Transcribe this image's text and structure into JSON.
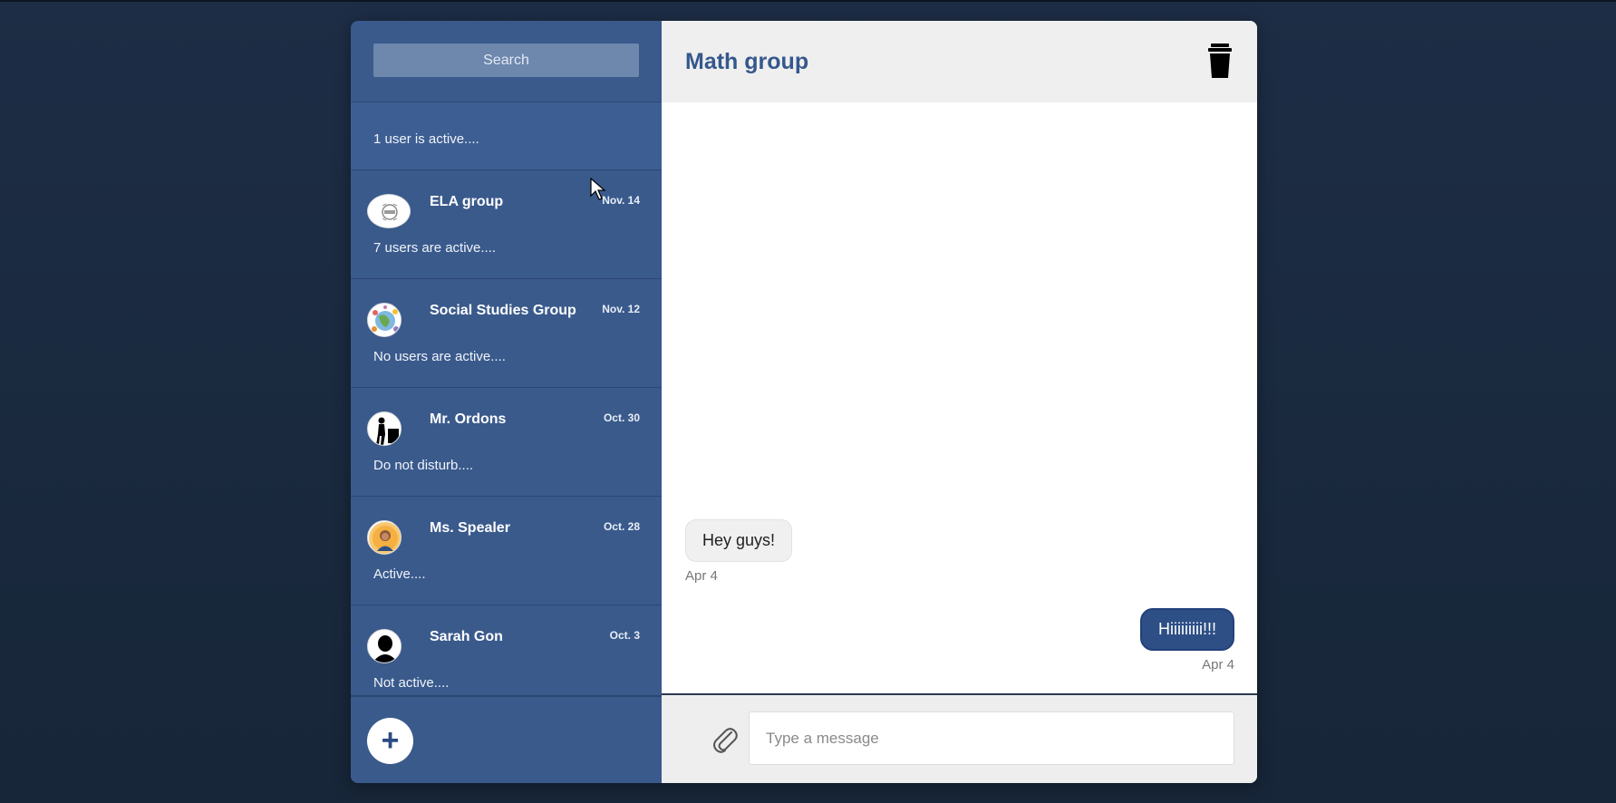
{
  "search": {
    "placeholder": "Search"
  },
  "chats": [
    {
      "name": "",
      "date": "",
      "status": "1 user is active....",
      "avatar": ""
    },
    {
      "name": "ELA group",
      "date": "Nov. 14",
      "status": "7 users are active....",
      "avatar": "ela-logo"
    },
    {
      "name": "Social Studies Group",
      "date": "Nov. 12",
      "status": "No users are active....",
      "avatar": "globe-collage"
    },
    {
      "name": "Mr. Ordons",
      "date": "Oct. 30",
      "status": "Do not disturb....",
      "avatar": "teacher-silhouette"
    },
    {
      "name": "Ms. Spealer",
      "date": "Oct. 28",
      "status": "Active....",
      "avatar": "teacher-portrait"
    },
    {
      "name": "Sarah Gon",
      "date": "Oct. 3",
      "status": "Not active....",
      "avatar": "person-silhouette"
    }
  ],
  "sidebar_footer": {
    "add_label": "+"
  },
  "conversation": {
    "title": "Math group",
    "messages": [
      {
        "direction": "in",
        "text": "Hey guys!",
        "date": "Apr 4"
      },
      {
        "direction": "out",
        "text": "Hiiiiiiiii!!!",
        "date": "Apr 4"
      }
    ]
  },
  "composer": {
    "placeholder": "Type a message"
  },
  "colors": {
    "background": "#1d2d45",
    "sidebar": "#3a5a8c",
    "accent": "#35578d",
    "outgoing_bubble": "#2e4f86"
  }
}
